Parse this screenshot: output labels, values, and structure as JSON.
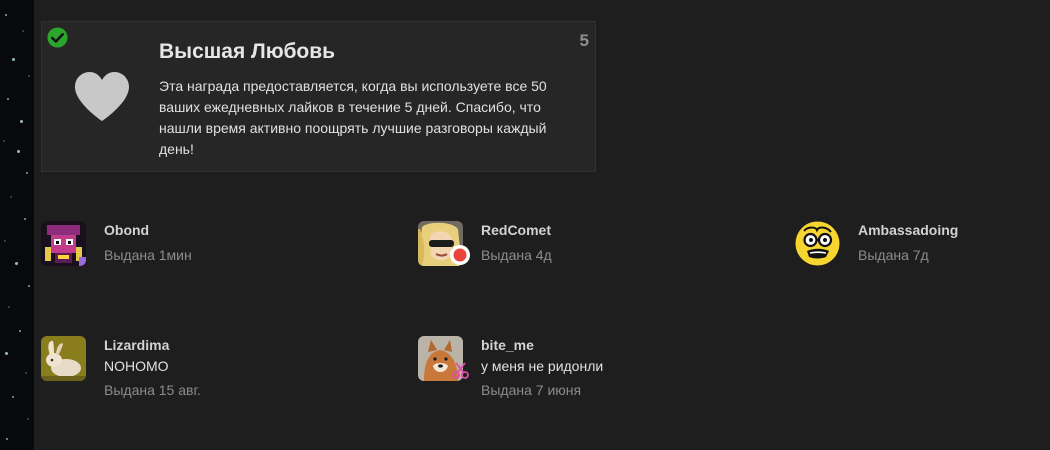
{
  "badge": {
    "title": "Высшая Любовь",
    "description": "Эта награда предоставляется, когда вы используете все 50 ваших ежедневных лайков в течение 5 дней. Спасибо, что нашли время активно поощрять лучшие разговоры каждый день!",
    "count": "5",
    "icon": "heart-icon",
    "granted_icon": "check-circle-icon"
  },
  "grants": [
    {
      "username": "Obond",
      "granted": "Выдана 1мин"
    },
    {
      "username": "RedComet",
      "granted": "Выдана 4д"
    },
    {
      "username": "Ambassadoing",
      "granted": "Выдана 7д"
    },
    {
      "username": "Lizardima",
      "post": "NOHOMO",
      "granted": "Выдана 15 авг."
    },
    {
      "username": "bite_me",
      "post": "у меня не ридонли",
      "granted": "Выдана 7 июня"
    }
  ],
  "colors": {
    "background": "#1e1e1e",
    "card": "#262626",
    "check": "#2ba52b",
    "heart": "#c8c8c8",
    "muted": "#8c8c8c"
  }
}
